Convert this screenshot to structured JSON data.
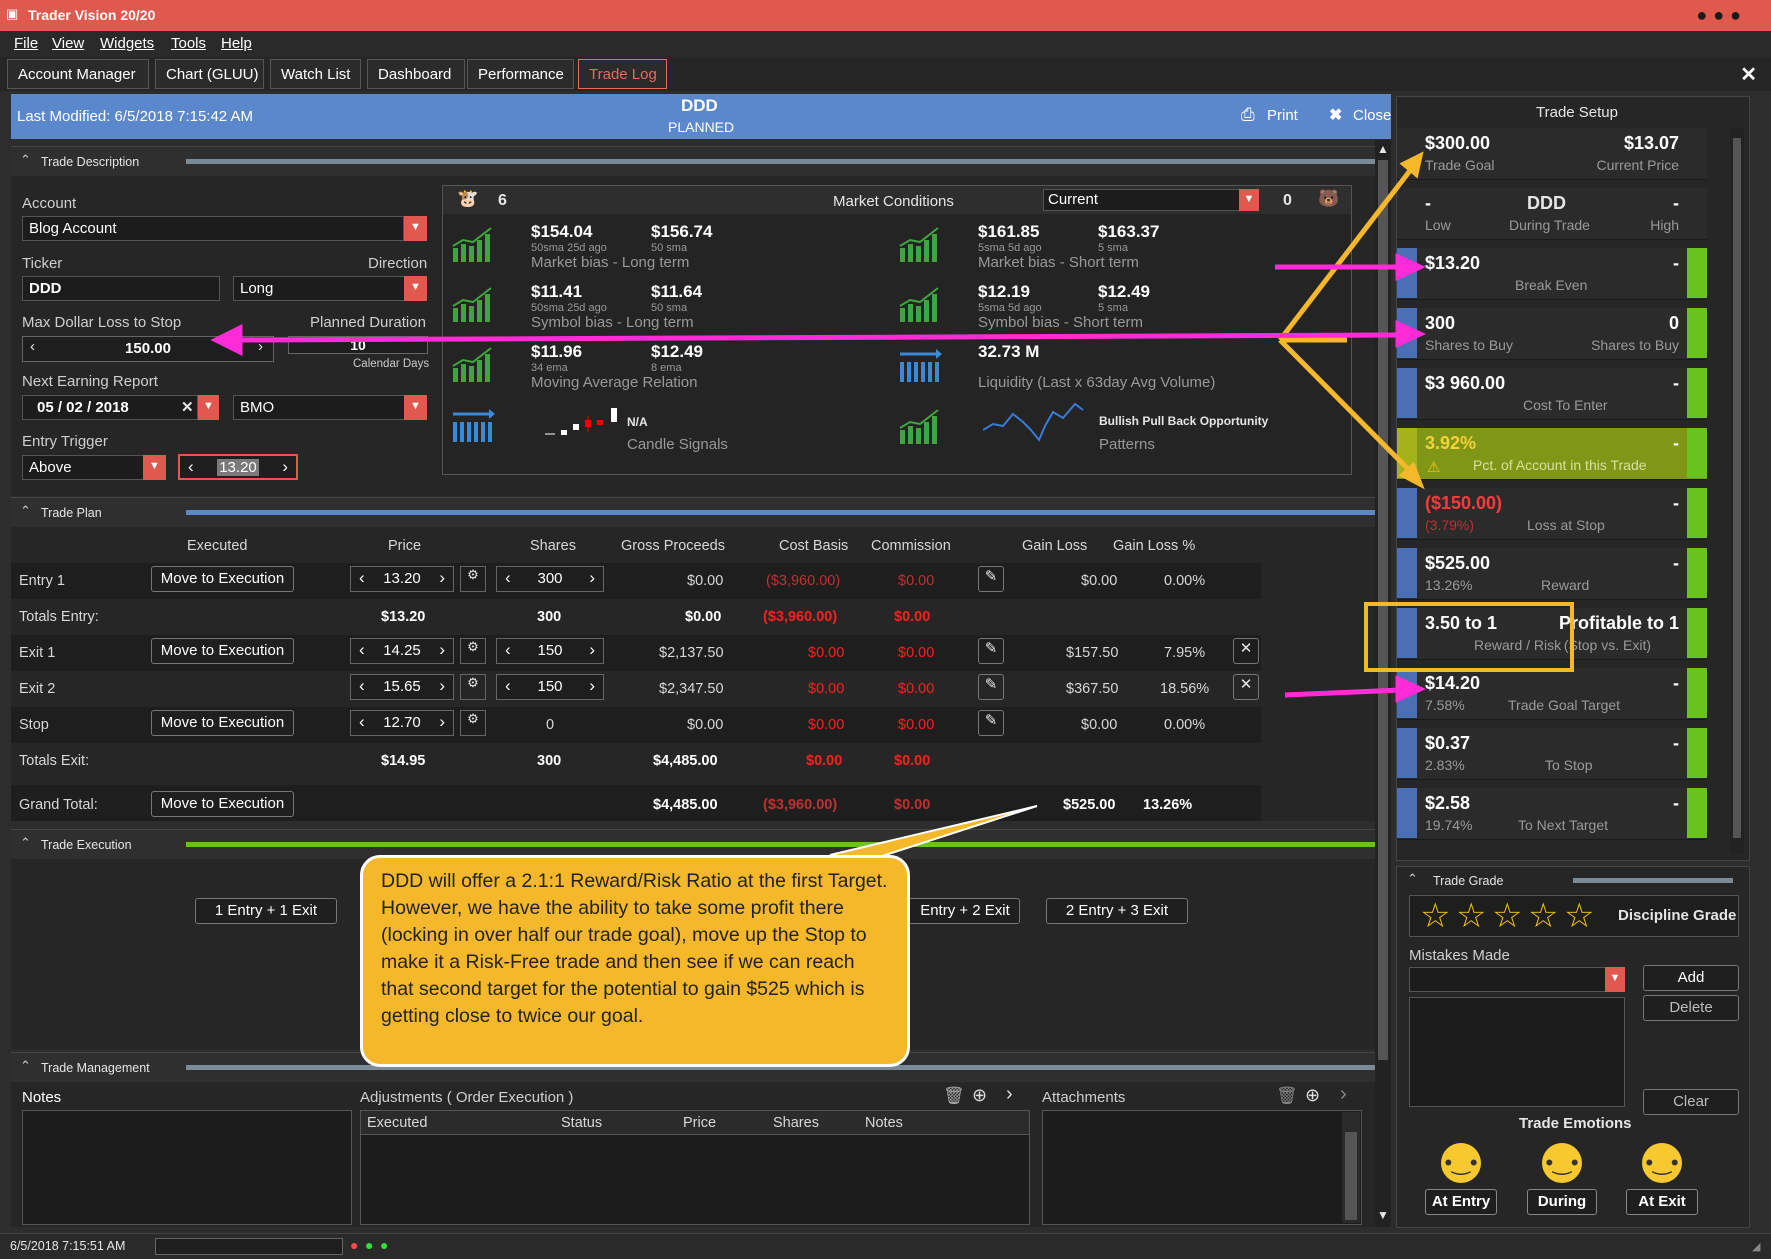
{
  "app": {
    "title": "Trader Vision 20/20"
  },
  "menu": [
    "File",
    "View",
    "Widgets",
    "Tools",
    "Help"
  ],
  "tabs": [
    "Account Manager",
    "Chart (GLUU)",
    "Watch List",
    "Dashboard",
    "Performance",
    "Trade Log"
  ],
  "header": {
    "last_modified": "Last Modified: 6/5/2018 7:15:42 AM",
    "symbol": "DDD",
    "status": "PLANNED",
    "print": "Print",
    "close": "Close"
  },
  "sections": {
    "desc": "Trade Description",
    "plan": "Trade Plan",
    "exec": "Trade Execution",
    "mgmt": "Trade Management"
  },
  "desc": {
    "account_label": "Account",
    "account": "Blog Account",
    "ticker_label": "Ticker",
    "ticker": "DDD",
    "direction_label": "Direction",
    "direction": "Long",
    "maxloss_label": "Max Dollar Loss to Stop",
    "maxloss": "150.00",
    "duration_label": "Planned Duration",
    "duration": "10",
    "duration_unit": "Calendar Days",
    "earnings_label": "Next Earning Report",
    "earnings_date": "05  /  02  /  2018",
    "earnings_time": "BMO",
    "entry_trigger_label": "Entry Trigger",
    "entry_trigger": "Above",
    "entry_value": "13.20"
  },
  "market": {
    "bull_count": "6",
    "label": "Market Conditions",
    "selected": "Current",
    "bear_count": "0",
    "cells": [
      {
        "v1": "$154.04",
        "s1": "50sma 25d ago",
        "v2": "$156.74",
        "s2": "50 sma",
        "cap": "Market bias - Long term"
      },
      {
        "v1": "$161.85",
        "s1": "5sma 5d ago",
        "v2": "$163.37",
        "s2": "5 sma",
        "cap": "Market bias - Short term"
      },
      {
        "v1": "$11.41",
        "s1": "50sma 25d ago",
        "v2": "$11.64",
        "s2": "50 sma",
        "cap": "Symbol bias - Long term"
      },
      {
        "v1": "$12.19",
        "s1": "5sma 5d ago",
        "v2": "$12.49",
        "s2": "5 sma",
        "cap": "Symbol bias - Short term"
      },
      {
        "v1": "$11.96",
        "s1": "34 ema",
        "v2": "$12.49",
        "s2": "8 ema",
        "cap": "Moving Average Relation"
      },
      {
        "v1": "32.73 M",
        "s1": "",
        "v2": "",
        "s2": "",
        "cap": "Liquidity (Last x 63day Avg Volume)"
      }
    ],
    "candle_val": "N/A",
    "candle_cap": "Candle Signals",
    "pattern_val": "Bullish Pull Back Opportunity",
    "pattern_cap": "Patterns"
  },
  "plan": {
    "headers": [
      "Executed",
      "Price",
      "Shares",
      "Gross Proceeds",
      "Cost Basis",
      "Commission",
      "Gain Loss",
      "Gain Loss %"
    ],
    "move": "Move to Execution",
    "entry1": {
      "label": "Entry 1",
      "price": "13.20",
      "shares": "300",
      "gross": "$0.00",
      "cost": "($3,960.00)",
      "comm": "$0.00",
      "gain": "$0.00",
      "pct": "0.00%"
    },
    "totals_entry": {
      "label": "Totals Entry:",
      "price": "$13.20",
      "shares": "300",
      "gross": "$0.00",
      "cost": "($3,960.00)",
      "comm": "$0.00"
    },
    "exit1": {
      "label": "Exit 1",
      "price": "14.25",
      "shares": "150",
      "gross": "$2,137.50",
      "cost": "$0.00",
      "comm": "$0.00",
      "gain": "$157.50",
      "pct": "7.95%"
    },
    "exit2": {
      "label": "Exit 2",
      "price": "15.65",
      "shares": "150",
      "gross": "$2,347.50",
      "cost": "$0.00",
      "comm": "$0.00",
      "gain": "$367.50",
      "pct": "18.56%"
    },
    "stop": {
      "label": "Stop",
      "price": "12.70",
      "shares": "0",
      "gross": "$0.00",
      "cost": "$0.00",
      "comm": "$0.00",
      "gain": "$0.00",
      "pct": "0.00%"
    },
    "totals_exit": {
      "label": "Totals Exit:",
      "price": "$14.95",
      "shares": "300",
      "gross": "$4,485.00",
      "cost": "$0.00",
      "comm": "$0.00"
    },
    "grand": {
      "label": "Grand Total:",
      "gross": "$4,485.00",
      "cost": "($3,960.00)",
      "comm": "$0.00",
      "gain": "$525.00",
      "pct": "13.26%"
    }
  },
  "exec": {
    "b1": "1 Entry + 1 Exit",
    "b2": "Entry + 2 Exit",
    "b3": "2 Entry + 3 Exit"
  },
  "callout": "DDD will offer a 2.1:1 Reward/Risk Ratio at the first Target.  However, we have the ability to take some profit there (locking in  over half our trade goal), move up the Stop to make it a Risk-Free trade and then see if we can reach that second target for the potential to gain $525 which is getting close to twice our goal.",
  "mgmt": {
    "notes": "Notes",
    "adjust": "Adjustments ( Order Execution )",
    "attach": "Attachments",
    "cols": [
      "Executed",
      "Status",
      "Price",
      "Shares",
      "Notes"
    ]
  },
  "setup": {
    "title": "Trade Setup",
    "r1": {
      "v": "$300.00",
      "s": "Trade Goal",
      "vr": "$13.07",
      "sr": "Current Price"
    },
    "r2": {
      "v": "-",
      "s": "Low",
      "vm": "DDD",
      "sm": "During Trade",
      "vr": "-",
      "sr": "High"
    },
    "r3": {
      "v": "$13.20",
      "s": "Break Even",
      "vr": "-"
    },
    "r4": {
      "v": "300",
      "s": "Shares to Buy",
      "vr": "0",
      "sr": "Shares to Buy"
    },
    "r5": {
      "v": "$3 960.00",
      "s": "Cost To Enter",
      "vr": "-"
    },
    "r6": {
      "v": "3.92%",
      "s": "Pct. of Account in this Trade",
      "vr": "-"
    },
    "r7": {
      "v": "($150.00)",
      "s0": "(3.79%)",
      "s": "Loss at Stop",
      "vr": "-"
    },
    "r8": {
      "v": "$525.00",
      "s0": "13.26%",
      "s": "Reward",
      "vr": "-"
    },
    "r9": {
      "v": "3.50 to 1",
      "s": "Reward / Risk",
      "vr": "Profitable to 1",
      "sr": "(Stop vs. Exit)"
    },
    "r10": {
      "v": "$14.20",
      "s0": "7.58%",
      "s": "Trade Goal Target",
      "vr": "-"
    },
    "r11": {
      "v": "$0.37",
      "s0": "2.83%",
      "s": "To Stop",
      "vr": "-"
    },
    "r12": {
      "v": "$2.58",
      "s0": "19.74%",
      "s": "To Next Target",
      "vr": "-"
    }
  },
  "grade": {
    "title": "Trade Grade",
    "discipline": "Discipline Grade",
    "mistakes": "Mistakes Made",
    "add": "Add",
    "delete": "Delete",
    "clear": "Clear",
    "emotions": "Trade Emotions",
    "at_entry": "At Entry",
    "during": "During",
    "at_exit": "At Exit"
  },
  "status": {
    "timestamp": "6/5/2018 7:15:51 AM"
  },
  "colors": {
    "title_bar": "#e1584e",
    "header_blue": "#5b87cd",
    "green": "#69c21e",
    "magenta": "#ff2bd6",
    "yellow": "#f5b82a"
  }
}
